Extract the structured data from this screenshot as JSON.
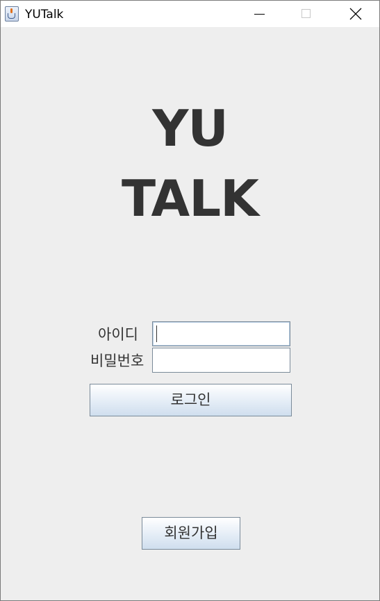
{
  "window": {
    "title": "YUTalk",
    "icon": "java-cup-icon",
    "controls": [
      "minimize-icon",
      "maximize-icon",
      "close-icon"
    ]
  },
  "logo": {
    "line1": "YU",
    "line2": "TALK"
  },
  "login_form": {
    "id_label": "아이디",
    "id_value": "",
    "password_label": "비밀번호",
    "password_value": "",
    "login_button": "로그인"
  },
  "signup_button": "회원가입",
  "colors": {
    "background": "#eeeeee",
    "text": "#333333",
    "button_gradient_bottom": "#cfdeee"
  }
}
